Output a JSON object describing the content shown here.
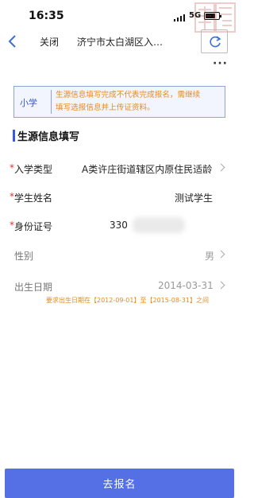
{
  "status_bar": {
    "time": "16:35",
    "network": "5G",
    "battery_level": 0.72,
    "watermark_text": "圖"
  },
  "nav": {
    "back_icon": "chevron-left-icon",
    "close_label": "关闭",
    "title": "济宁市太白湖区入…",
    "refresh_icon": "refresh-icon",
    "more_label": "···"
  },
  "notice": {
    "tag": "小学",
    "text_line1": "生源信息填写完成不代表完成报名，需继续",
    "text_line2": "填写选报信息并上传证资料。"
  },
  "section": {
    "title": "生源信息填写"
  },
  "form": {
    "required_mark": "*",
    "fields": [
      {
        "label": "入学类型",
        "value": "A类许庄街道辖区内原住民适龄",
        "required": true,
        "chevron": true
      },
      {
        "label": "学生姓名",
        "value": "测试学生",
        "required": true,
        "chevron": false
      },
      {
        "label": "身份证号",
        "value": "330",
        "required": true,
        "chevron": false,
        "masked": true
      },
      {
        "label": "性别",
        "value": "男",
        "required": false,
        "chevron": true
      },
      {
        "label": "出生日期",
        "value": "2014-03-31",
        "required": false,
        "chevron": true
      }
    ],
    "date_hint": "要求出生日期在【2012-09-01】至【2015-08-31】之间"
  },
  "footer": {
    "submit_label": "去报名"
  },
  "colors": {
    "accent": "#5470e4",
    "warning": "#e68a1e",
    "required": "#d33333"
  }
}
